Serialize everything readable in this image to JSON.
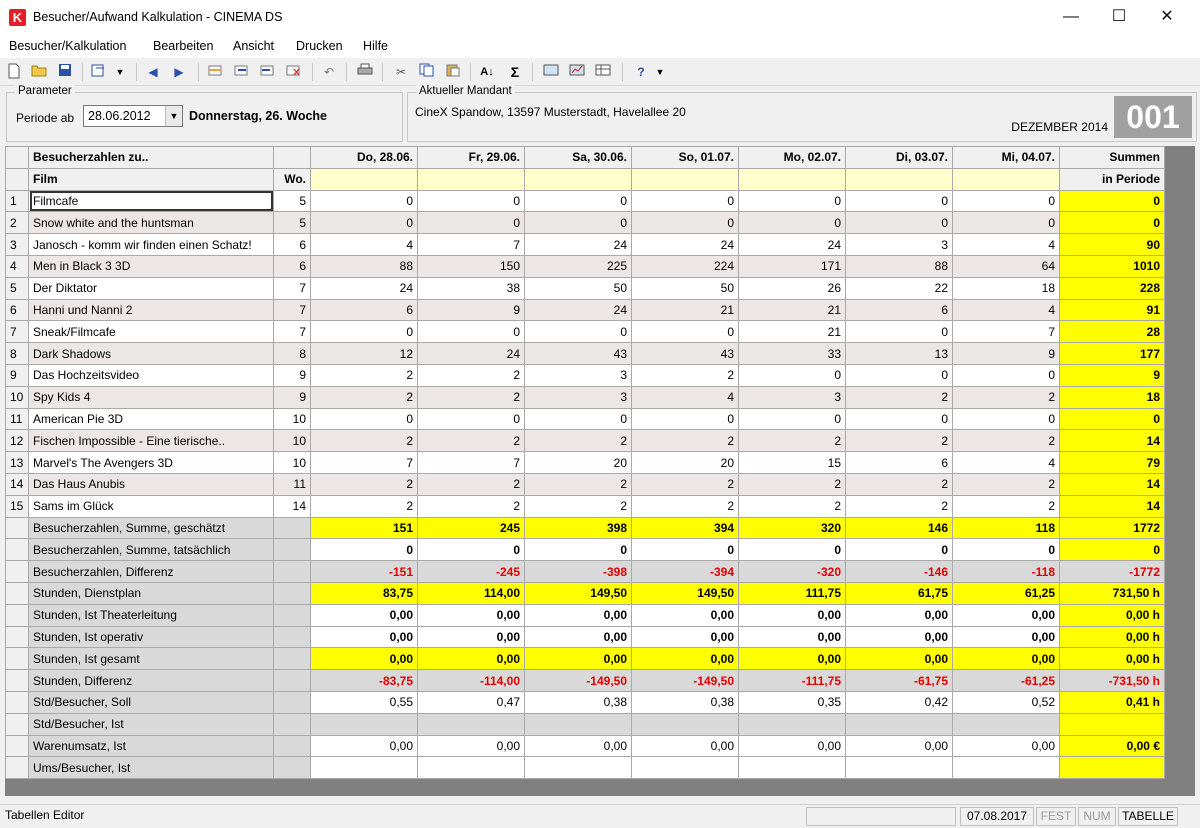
{
  "window": {
    "icon_letter": "K",
    "title": "Besucher/Aufwand Kalkulation - CINEMA DS",
    "minimize": "—",
    "maximize": "☐",
    "close": "✕"
  },
  "menu": [
    "Besucher/Kalkulation",
    "Bearbeiten",
    "Ansicht",
    "Drucken",
    "Hilfe"
  ],
  "toolbar_icons": [
    "new-file-icon",
    "open-folder-icon",
    "save-icon",
    "export-icon",
    "arrow-left-icon",
    "arrow-right-icon",
    "insert-row-icon",
    "insert-left-icon",
    "insert-right-icon",
    "delete-row-icon",
    "undo-icon",
    "print-icon",
    "cut-icon",
    "copy-icon",
    "paste-icon",
    "sort-icon",
    "sum-icon",
    "image-icon",
    "chart-icon",
    "table-icon",
    "help-icon"
  ],
  "parameter": {
    "legend": "Parameter",
    "periode_label": "Periode ab",
    "date_value": "28.06.2012",
    "weekday_text": "Donnerstag, 26. Woche"
  },
  "mandant": {
    "legend": "Aktueller Mandant",
    "text": "CineX Spandow, 13597 Musterstadt, Havelallee 20",
    "month": "DEZEMBER 2014",
    "code": "001"
  },
  "grid": {
    "header_title": "Besucherzahlen zu..",
    "sub_film": "Film",
    "sub_wo": "Wo.",
    "sum_header": "Summen",
    "sum_sub": "in Periode",
    "days": [
      "Do, 28.06.",
      "Fr, 29.06.",
      "Sa, 30.06.",
      "So, 01.07.",
      "Mo, 02.07.",
      "Di, 03.07.",
      "Mi, 04.07."
    ],
    "films": [
      {
        "n": "1",
        "film": "Filmcafe",
        "wo": "5",
        "v": [
          "0",
          "0",
          "0",
          "0",
          "0",
          "0",
          "0"
        ],
        "sum": "0"
      },
      {
        "n": "2",
        "film": "Snow white and the huntsman",
        "wo": "5",
        "v": [
          "0",
          "0",
          "0",
          "0",
          "0",
          "0",
          "0"
        ],
        "sum": "0"
      },
      {
        "n": "3",
        "film": "Janosch - komm wir finden einen Schatz!",
        "wo": "6",
        "v": [
          "4",
          "7",
          "24",
          "24",
          "24",
          "3",
          "4"
        ],
        "sum": "90"
      },
      {
        "n": "4",
        "film": "Men in Black 3 3D",
        "wo": "6",
        "v": [
          "88",
          "150",
          "225",
          "224",
          "171",
          "88",
          "64"
        ],
        "sum": "1010"
      },
      {
        "n": "5",
        "film": "Der Diktator",
        "wo": "7",
        "v": [
          "24",
          "38",
          "50",
          "50",
          "26",
          "22",
          "18"
        ],
        "sum": "228"
      },
      {
        "n": "6",
        "film": "Hanni und Nanni 2",
        "wo": "7",
        "v": [
          "6",
          "9",
          "24",
          "21",
          "21",
          "6",
          "4"
        ],
        "sum": "91"
      },
      {
        "n": "7",
        "film": "Sneak/Filmcafe",
        "wo": "7",
        "v": [
          "0",
          "0",
          "0",
          "0",
          "21",
          "0",
          "7"
        ],
        "sum": "28"
      },
      {
        "n": "8",
        "film": "Dark Shadows",
        "wo": "8",
        "v": [
          "12",
          "24",
          "43",
          "43",
          "33",
          "13",
          "9"
        ],
        "sum": "177"
      },
      {
        "n": "9",
        "film": "Das Hochzeitsvideo",
        "wo": "9",
        "v": [
          "2",
          "2",
          "3",
          "2",
          "0",
          "0",
          "0"
        ],
        "sum": "9"
      },
      {
        "n": "10",
        "film": "Spy Kids 4",
        "wo": "9",
        "v": [
          "2",
          "2",
          "3",
          "4",
          "3",
          "2",
          "2"
        ],
        "sum": "18"
      },
      {
        "n": "11",
        "film": "American Pie 3D",
        "wo": "10",
        "v": [
          "0",
          "0",
          "0",
          "0",
          "0",
          "0",
          "0"
        ],
        "sum": "0"
      },
      {
        "n": "12",
        "film": "Fischen Impossible - Eine tierische..",
        "wo": "10",
        "v": [
          "2",
          "2",
          "2",
          "2",
          "2",
          "2",
          "2"
        ],
        "sum": "14"
      },
      {
        "n": "13",
        "film": "Marvel's The Avengers 3D",
        "wo": "10",
        "v": [
          "7",
          "7",
          "20",
          "20",
          "15",
          "6",
          "4"
        ],
        "sum": "79"
      },
      {
        "n": "14",
        "film": "Das Haus Anubis",
        "wo": "11",
        "v": [
          "2",
          "2",
          "2",
          "2",
          "2",
          "2",
          "2"
        ],
        "sum": "14"
      },
      {
        "n": "15",
        "film": "Sams im Glück",
        "wo": "14",
        "v": [
          "2",
          "2",
          "2",
          "2",
          "2",
          "2",
          "2"
        ],
        "sum": "14"
      }
    ],
    "summary": [
      {
        "label": "Besucherzahlen, Summe, geschätzt",
        "v": [
          "151",
          "245",
          "398",
          "394",
          "320",
          "146",
          "118"
        ],
        "sum": "1772",
        "cell": "vyellow",
        "style": "bold"
      },
      {
        "label": "Besucherzahlen, Summe, tatsächlich",
        "v": [
          "0",
          "0",
          "0",
          "0",
          "0",
          "0",
          "0"
        ],
        "sum": "0",
        "cell": "vwhite",
        "style": "bold"
      },
      {
        "label": "Besucherzahlen, Differenz",
        "v": [
          "-151",
          "-245",
          "-398",
          "-394",
          "-320",
          "-146",
          "-118"
        ],
        "sum": "-1772",
        "cell": "vgrey",
        "style": "red"
      },
      {
        "label": "Stunden, Dienstplan",
        "v": [
          "83,75",
          "114,00",
          "149,50",
          "149,50",
          "111,75",
          "61,75",
          "61,25"
        ],
        "sum": "731,50 h",
        "cell": "vyellow",
        "style": "bold"
      },
      {
        "label": "Stunden, Ist Theaterleitung",
        "v": [
          "0,00",
          "0,00",
          "0,00",
          "0,00",
          "0,00",
          "0,00",
          "0,00"
        ],
        "sum": "0,00 h",
        "cell": "vwhite",
        "style": "bold"
      },
      {
        "label": "Stunden, Ist operativ",
        "v": [
          "0,00",
          "0,00",
          "0,00",
          "0,00",
          "0,00",
          "0,00",
          "0,00"
        ],
        "sum": "0,00 h",
        "cell": "vwhite",
        "style": "bold"
      },
      {
        "label": "Stunden, Ist gesamt",
        "v": [
          "0,00",
          "0,00",
          "0,00",
          "0,00",
          "0,00",
          "0,00",
          "0,00"
        ],
        "sum": "0,00 h",
        "cell": "vyellow",
        "style": "bold"
      },
      {
        "label": "Stunden, Differenz",
        "v": [
          "-83,75",
          "-114,00",
          "-149,50",
          "-149,50",
          "-111,75",
          "-61,75",
          "-61,25"
        ],
        "sum": "-731,50 h",
        "cell": "vgrey",
        "style": "red"
      },
      {
        "label": "Std/Besucher, Soll",
        "v": [
          "0,55",
          "0,47",
          "0,38",
          "0,38",
          "0,35",
          "0,42",
          "0,52"
        ],
        "sum": "0,41 h",
        "cell": "vwhite",
        "style": "plain"
      },
      {
        "label": "Std/Besucher, Ist",
        "v": [
          "",
          "",
          "",
          "",
          "",
          "",
          ""
        ],
        "sum": "",
        "cell": "vgrey",
        "style": "plain"
      },
      {
        "label": "Warenumsatz, Ist",
        "v": [
          "0,00",
          "0,00",
          "0,00",
          "0,00",
          "0,00",
          "0,00",
          "0,00"
        ],
        "sum": "0,00 €",
        "cell": "vwhite",
        "style": "plain"
      },
      {
        "label": "Ums/Besucher, Ist",
        "v": [
          "",
          "",
          "",
          "",
          "",
          "",
          ""
        ],
        "sum": "",
        "cell": "vwhite",
        "style": "plain"
      }
    ]
  },
  "status": {
    "editor": "Tabellen Editor",
    "date": "07.08.2017",
    "fest": "FEST",
    "num": "NUM",
    "tabelle": "TABELLE"
  },
  "colors": {
    "highlight_yellow": "#ffff00",
    "negative_red": "#e00000",
    "app_icon_red": "#e41e26"
  }
}
